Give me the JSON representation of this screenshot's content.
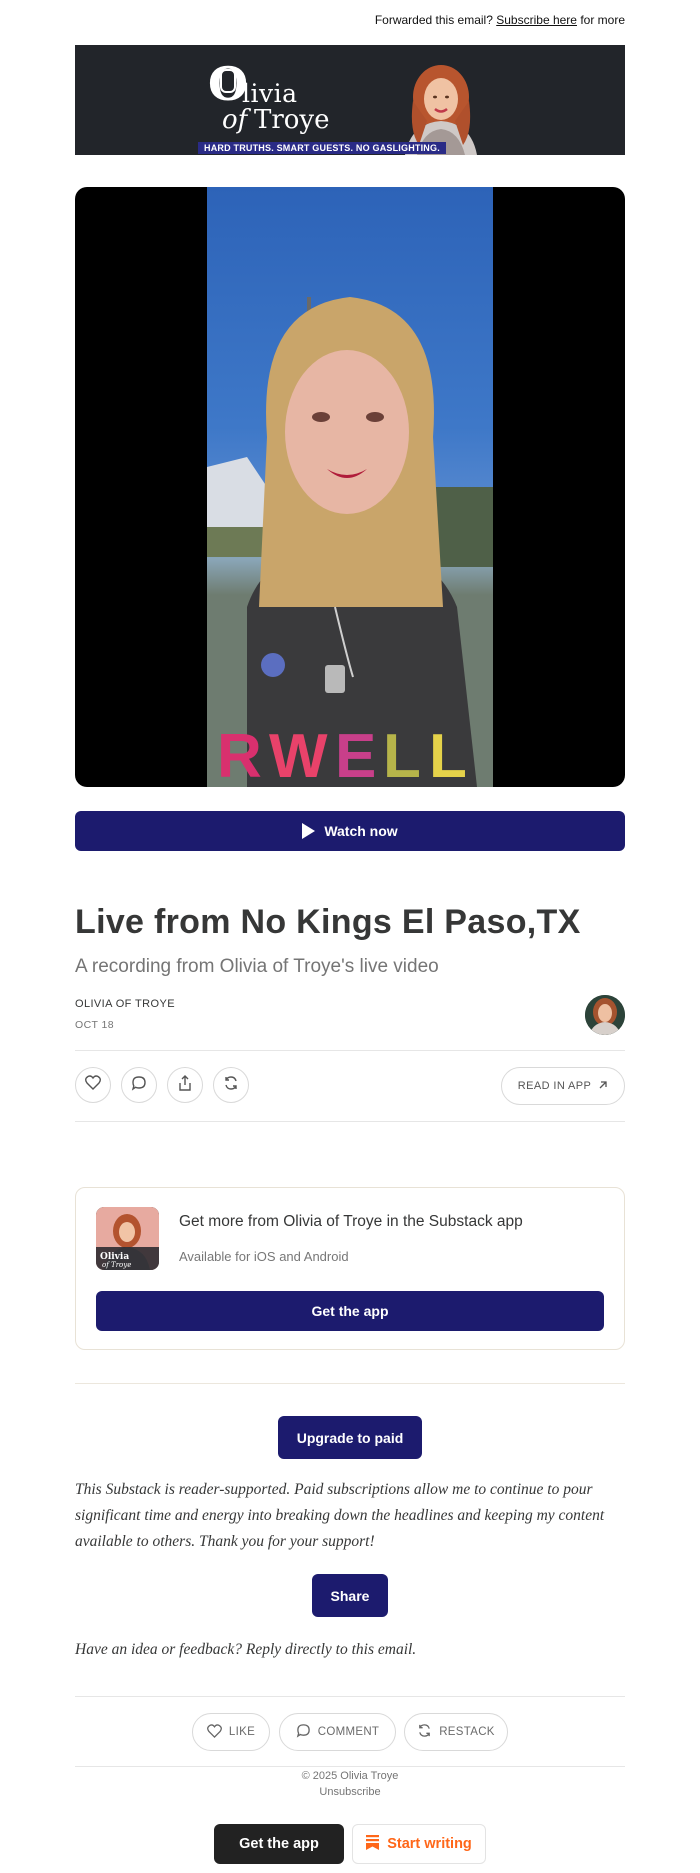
{
  "forward": {
    "prefix": "Forwarded this email?",
    "link": "Subscribe here",
    "suffix": "for more"
  },
  "banner": {
    "brand_o": "O",
    "brand_livia": "livia",
    "brand_of": "of",
    "brand_troye": "Troye",
    "tagline": "HARD TRUTHS. SMART GUESTS. NO GASLIGHTING."
  },
  "post": {
    "watch_label": "Watch now",
    "title": "Live from No Kings El Paso,TX",
    "subtitle": "A recording from Olivia of Troye's live video",
    "author": "OLIVIA OF TROYE",
    "date": "OCT 18",
    "read_in_app": "READ IN APP"
  },
  "app_card": {
    "title": "Get more from Olivia of Troye in the Substack app",
    "subtitle": "Available for iOS and Android",
    "button": "Get the app"
  },
  "footer": {
    "upgrade": "Upgrade to paid",
    "paragraph": "This Substack is reader-supported. Paid subscriptions allow me to continue to pour significant time and energy into breaking down the headlines and keeping my content available to others. Thank you for your support!",
    "share": "Share",
    "idea": "Have an idea or feedback? Reply directly to this email.",
    "like": "LIKE",
    "comment": "COMMENT",
    "restack": "RESTACK",
    "copyright": "© 2025 Olivia Troye",
    "unsubscribe": "Unsubscribe",
    "get_app": "Get the app",
    "start_writing": "Start writing"
  },
  "colors": {
    "primary": "#1c1b6e",
    "banner_bg": "#22252a",
    "substack_orange": "#ff6719"
  }
}
